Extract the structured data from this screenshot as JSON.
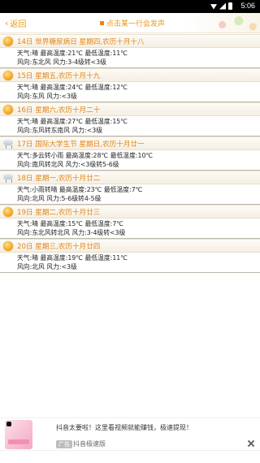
{
  "status_bar": {
    "time": "5:06"
  },
  "top_bar": {
    "back_label": "返回",
    "hint": "点击某一行会发声"
  },
  "days": [
    {
      "date": "14日 世界糖尿病日 星期四,农历十月十八",
      "icon": "sun-icon",
      "weather": "天气:晴",
      "max_label": "最高温度:21℃",
      "min_label": "最低温度:11℃",
      "wind": "风向:东北风 风力:3-4级转<3级"
    },
    {
      "date": "15日 星期五,农历十月十九",
      "icon": "sun-icon",
      "weather": "天气:晴",
      "max_label": "最高温度:24℃",
      "min_label": "最低温度:12℃",
      "wind": "风向:东风 风力:<3级"
    },
    {
      "date": "16日 星期六,农历十月二十",
      "icon": "sun-icon",
      "weather": "天气:晴",
      "max_label": "最高温度:27℃",
      "min_label": "最低温度:15℃",
      "wind": "风向:东风转东南风 风力:<3级"
    },
    {
      "date": "17日 国际大学生节 星期日,农历十月廿一",
      "icon": "rain-icon",
      "weather": "天气:多云转小雨",
      "max_label": "最高温度:28℃",
      "min_label": "最低温度:10℃",
      "wind": "风向:南风转北风 风力:<3级转5-6级"
    },
    {
      "date": "18日 星期一,农历十月廿二",
      "icon": "rain-icon",
      "weather": "天气:小雨转晴",
      "max_label": "最高温度:23℃",
      "min_label": "最低温度:7℃",
      "wind": "风向:北风 风力:5-6级转4-5级"
    },
    {
      "date": "19日 星期二,农历十月廿三",
      "icon": "sun-icon",
      "weather": "天气:晴",
      "max_label": "最高温度:15℃",
      "min_label": "最低温度:7℃",
      "wind": "风向:东北风转北风 风力:3-4级转<3级"
    },
    {
      "date": "20日 星期三,农历十月廿四",
      "icon": "sun-icon",
      "weather": "天气:晴",
      "max_label": "最高温度:19℃",
      "min_label": "最低温度:11℃",
      "wind": "风向:北风 风力:<3级"
    }
  ],
  "ad": {
    "text": "抖音太要啦！这里看视频就能赚钱，极速提现！",
    "tag": "广告",
    "source": "抖音极速版"
  }
}
